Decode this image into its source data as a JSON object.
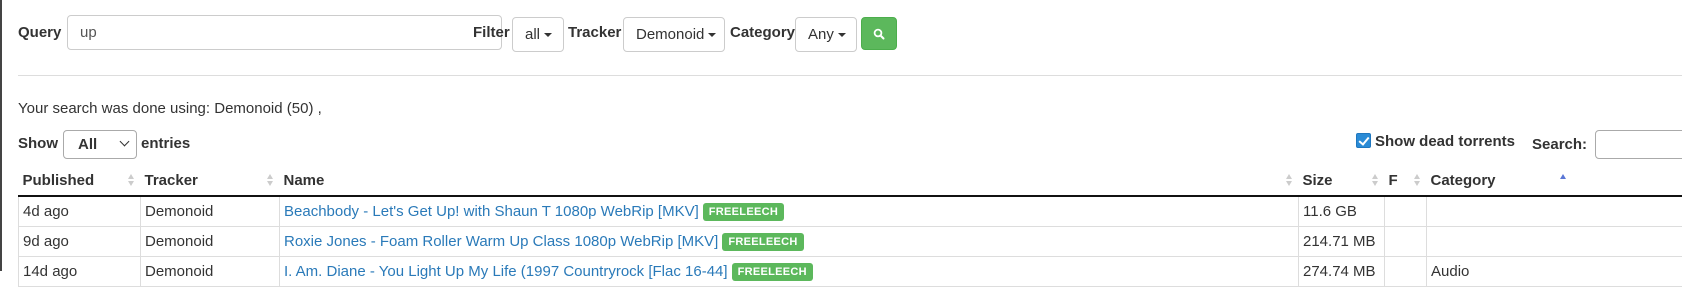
{
  "search": {
    "query_label": "Query",
    "query_value": "up",
    "filter_label": "Filter",
    "filter_value": "all",
    "tracker_label": "Tracker",
    "tracker_value": "Demonoid",
    "category_label": "Category",
    "category_value": "Any",
    "submit_icon": "search-icon"
  },
  "info_text": "Your search was done using: Demonoid (50) ,",
  "table_controls": {
    "show_label": "Show",
    "entries_value": "All",
    "entries_label": "entries",
    "dead_torrents_label": "Show dead torrents",
    "dead_torrents_checked": true,
    "search_label": "Search:",
    "search_value": ""
  },
  "table": {
    "headers": [
      "Published",
      "Tracker",
      "Name",
      "Size",
      "F",
      "Category"
    ],
    "rows": [
      {
        "published": "4d ago",
        "tracker": "Demonoid",
        "name": "Beachbody - Let's Get Up! with Shaun T 1080p WebRip [MKV]",
        "badge": "FREELEECH",
        "size": "11.6 GB",
        "f": "",
        "category": ""
      },
      {
        "published": "9d ago",
        "tracker": "Demonoid",
        "name": "Roxie Jones - Foam Roller Warm Up Class 1080p WebRip [MKV]",
        "badge": "FREELEECH",
        "size": "214.71 MB",
        "f": "",
        "category": ""
      },
      {
        "published": "14d ago",
        "tracker": "Demonoid",
        "name": "I. Am. Diane - You Light Up My Life (1997 Countryrock [Flac 16-44]",
        "badge": "FREELEECH",
        "size": "274.74 MB",
        "f": "",
        "category": "Audio"
      }
    ]
  },
  "colors": {
    "accent_green": "#5cb85c",
    "link_blue": "#2a7ab9",
    "checkbox_blue": "#2a8bd6"
  }
}
